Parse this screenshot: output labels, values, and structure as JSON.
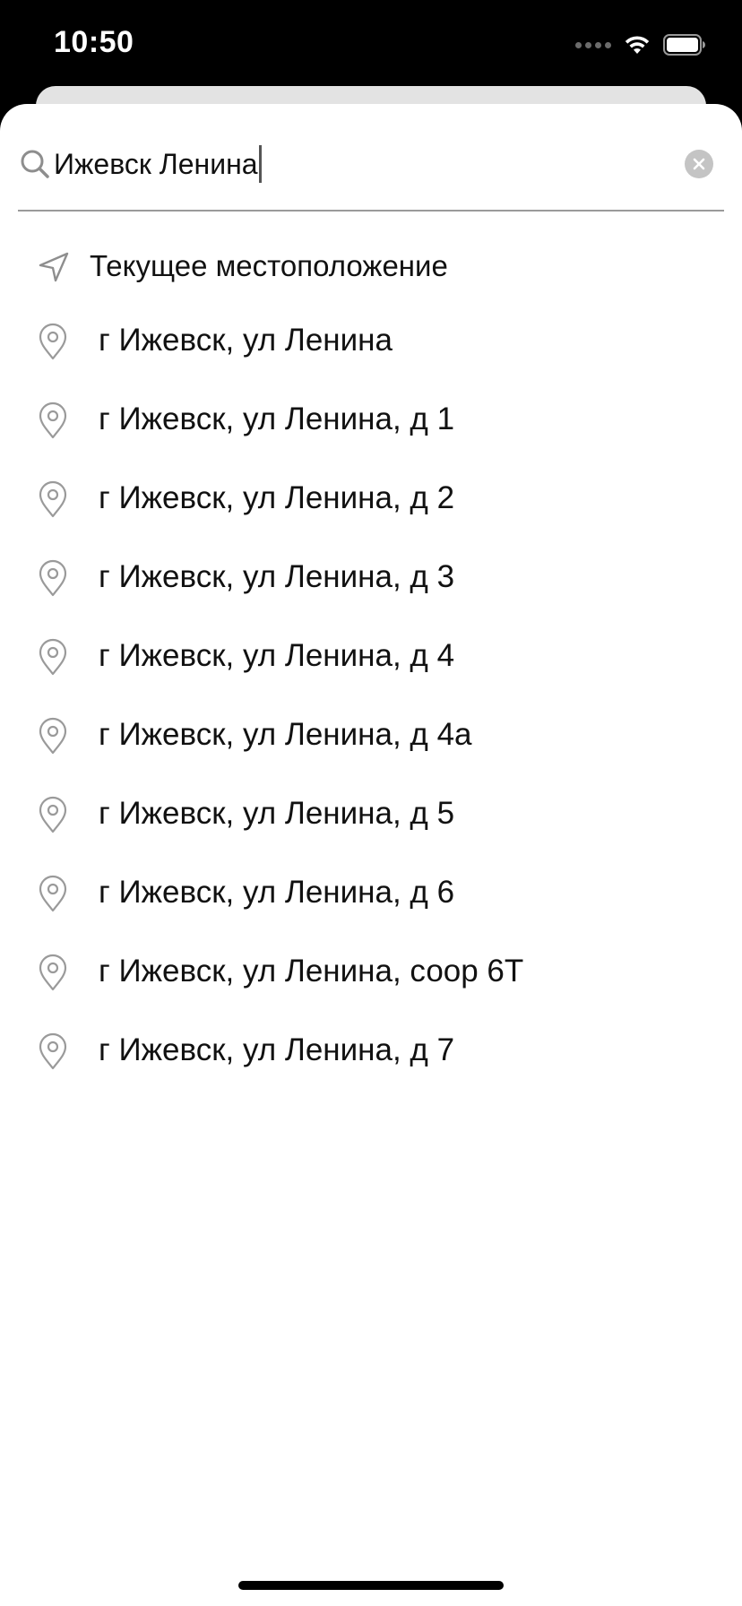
{
  "status_bar": {
    "time": "10:50",
    "icons": [
      "cellular-signal-icon",
      "wifi-icon",
      "battery-icon"
    ]
  },
  "search": {
    "value": "Ижевск Ленина",
    "icon": "search-icon",
    "clear_icon": "clear-icon"
  },
  "current_location": {
    "label": "Текущее местоположение",
    "icon": "location-arrow-icon"
  },
  "results": [
    {
      "label": "г Ижевск, ул Ленина",
      "icon": "map-pin-icon"
    },
    {
      "label": "г Ижевск, ул Ленина, д 1",
      "icon": "map-pin-icon"
    },
    {
      "label": "г Ижевск, ул Ленина, д 2",
      "icon": "map-pin-icon"
    },
    {
      "label": "г Ижевск, ул Ленина, д 3",
      "icon": "map-pin-icon"
    },
    {
      "label": "г Ижевск, ул Ленина, д 4",
      "icon": "map-pin-icon"
    },
    {
      "label": "г Ижевск, ул Ленина, д 4а",
      "icon": "map-pin-icon"
    },
    {
      "label": "г Ижевск, ул Ленина, д 5",
      "icon": "map-pin-icon"
    },
    {
      "label": "г Ижевск, ул Ленина, д 6",
      "icon": "map-pin-icon"
    },
    {
      "label": "г Ижевск, ул Ленина, соор 6Т",
      "icon": "map-pin-icon"
    },
    {
      "label": "г Ижевск, ул Ленина, д 7",
      "icon": "map-pin-icon"
    }
  ],
  "colors": {
    "status_background": "#000000",
    "sheet_background": "#ffffff",
    "text": "#111111",
    "icon_gray": "#8e8e8e",
    "divider": "#9a9a9a"
  }
}
